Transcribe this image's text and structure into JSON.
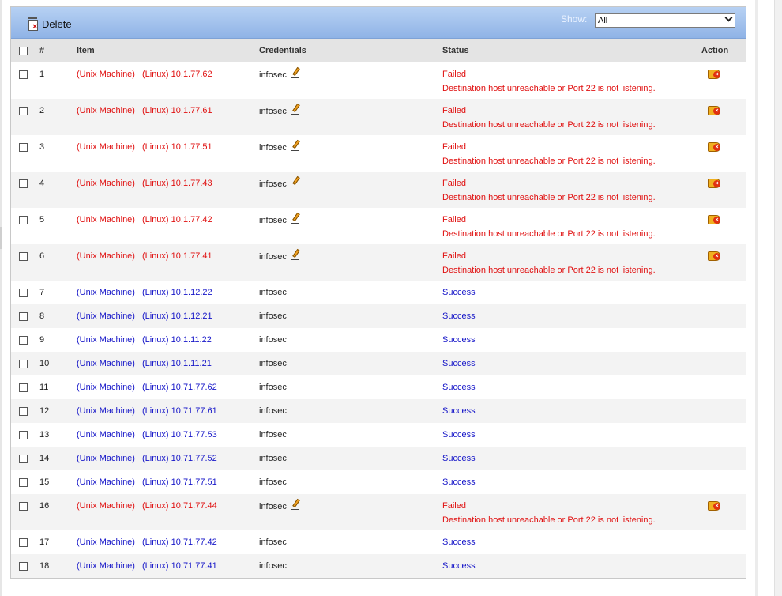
{
  "toolbar": {
    "delete_label": "Delete",
    "show_label": "Show:",
    "show_value": "All"
  },
  "table": {
    "headers": {
      "num": "#",
      "item": "Item",
      "credentials": "Credentials",
      "status": "Status",
      "action": "Action"
    },
    "rows": [
      {
        "num": "1",
        "type": "(Unix Machine)",
        "os_ip": "(Linux) 10.1.77.62",
        "cred": "infosec",
        "status": "Failed",
        "message": "Destination host unreachable or Port 22 is not listening.",
        "failed": true
      },
      {
        "num": "2",
        "type": "(Unix Machine)",
        "os_ip": "(Linux) 10.1.77.61",
        "cred": "infosec",
        "status": "Failed",
        "message": "Destination host unreachable or Port 22 is not listening.",
        "failed": true
      },
      {
        "num": "3",
        "type": "(Unix Machine)",
        "os_ip": "(Linux) 10.1.77.51",
        "cred": "infosec",
        "status": "Failed",
        "message": "Destination host unreachable or Port 22 is not listening.",
        "failed": true
      },
      {
        "num": "4",
        "type": "(Unix Machine)",
        "os_ip": "(Linux) 10.1.77.43",
        "cred": "infosec",
        "status": "Failed",
        "message": "Destination host unreachable or Port 22 is not listening.",
        "failed": true
      },
      {
        "num": "5",
        "type": "(Unix Machine)",
        "os_ip": "(Linux) 10.1.77.42",
        "cred": "infosec",
        "status": "Failed",
        "message": "Destination host unreachable or Port 22 is not listening.",
        "failed": true
      },
      {
        "num": "6",
        "type": "(Unix Machine)",
        "os_ip": "(Linux) 10.1.77.41",
        "cred": "infosec",
        "status": "Failed",
        "message": "Destination host unreachable or Port 22 is not listening.",
        "failed": true
      },
      {
        "num": "7",
        "type": "(Unix Machine)",
        "os_ip": "(Linux) 10.1.12.22",
        "cred": "infosec",
        "status": "Success",
        "message": "",
        "failed": false
      },
      {
        "num": "8",
        "type": "(Unix Machine)",
        "os_ip": "(Linux) 10.1.12.21",
        "cred": "infosec",
        "status": "Success",
        "message": "",
        "failed": false
      },
      {
        "num": "9",
        "type": "(Unix Machine)",
        "os_ip": "(Linux) 10.1.11.22",
        "cred": "infosec",
        "status": "Success",
        "message": "",
        "failed": false
      },
      {
        "num": "10",
        "type": "(Unix Machine)",
        "os_ip": "(Linux) 10.1.11.21",
        "cred": "infosec",
        "status": "Success",
        "message": "",
        "failed": false
      },
      {
        "num": "11",
        "type": "(Unix Machine)",
        "os_ip": "(Linux) 10.71.77.62",
        "cred": "infosec",
        "status": "Success",
        "message": "",
        "failed": false
      },
      {
        "num": "12",
        "type": "(Unix Machine)",
        "os_ip": "(Linux) 10.71.77.61",
        "cred": "infosec",
        "status": "Success",
        "message": "",
        "failed": false
      },
      {
        "num": "13",
        "type": "(Unix Machine)",
        "os_ip": "(Linux) 10.71.77.53",
        "cred": "infosec",
        "status": "Success",
        "message": "",
        "failed": false
      },
      {
        "num": "14",
        "type": "(Unix Machine)",
        "os_ip": "(Linux) 10.71.77.52",
        "cred": "infosec",
        "status": "Success",
        "message": "",
        "failed": false
      },
      {
        "num": "15",
        "type": "(Unix Machine)",
        "os_ip": "(Linux) 10.71.77.51",
        "cred": "infosec",
        "status": "Success",
        "message": "",
        "failed": false
      },
      {
        "num": "16",
        "type": "(Unix Machine)",
        "os_ip": "(Linux) 10.71.77.44",
        "cred": "infosec",
        "status": "Failed",
        "message": "Destination host unreachable or Port 22 is not listening.",
        "failed": true
      },
      {
        "num": "17",
        "type": "(Unix Machine)",
        "os_ip": "(Linux) 10.71.77.42",
        "cred": "infosec",
        "status": "Success",
        "message": "",
        "failed": false
      },
      {
        "num": "18",
        "type": "(Unix Machine)",
        "os_ip": "(Linux) 10.71.77.41",
        "cred": "infosec",
        "status": "Success",
        "message": "",
        "failed": false
      }
    ]
  },
  "icons": {
    "delete": "trash-icon",
    "edit": "pencil-icon",
    "action": "remove-tag-icon"
  },
  "colors": {
    "failed": "#e01010",
    "success": "#1515c8",
    "toolbar_top": "#b7d1f3",
    "toolbar_bottom": "#8fb3e6",
    "header_bg": "#e4e4e4",
    "alt_row": "#f3f3f3"
  }
}
